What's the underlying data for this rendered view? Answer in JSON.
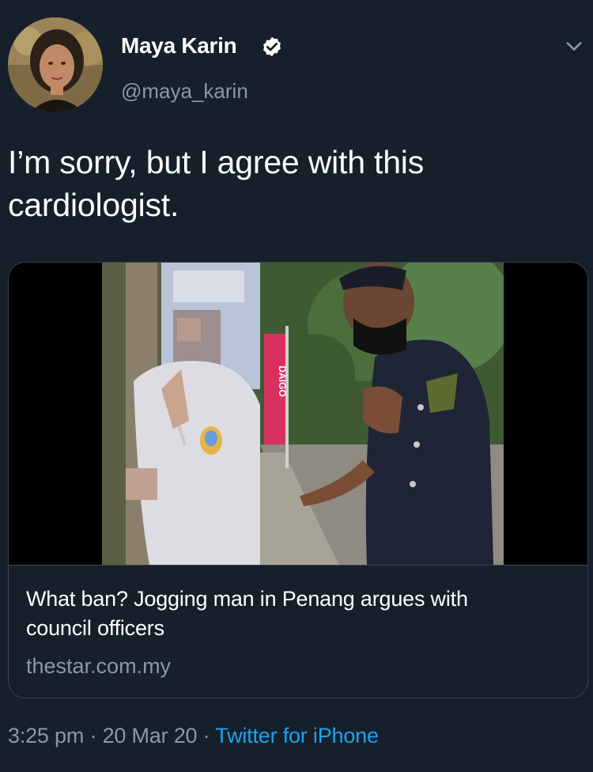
{
  "author": {
    "name": "Maya Karin",
    "handle": "@maya_karin",
    "avatar_icon": "user-avatar-photo",
    "verified_icon": "verified-badge-icon"
  },
  "tweet": {
    "text_line1": "I’m sorry, but I agree with this",
    "text_line2": "cardiologist."
  },
  "card": {
    "title_line1": "What ban? Jogging man in Penang argues with",
    "title_line2": "council officers",
    "domain": "thestar.com.my",
    "media_banner_text": "DAIGO"
  },
  "meta": {
    "time": "3:25 pm",
    "separator": " · ",
    "date": "20 Mar 20",
    "source": "Twitter for iPhone"
  },
  "colors": {
    "background": "#15202b",
    "secondary_text": "#8899a6",
    "accent": "#1da1f2",
    "border": "#38444d"
  }
}
